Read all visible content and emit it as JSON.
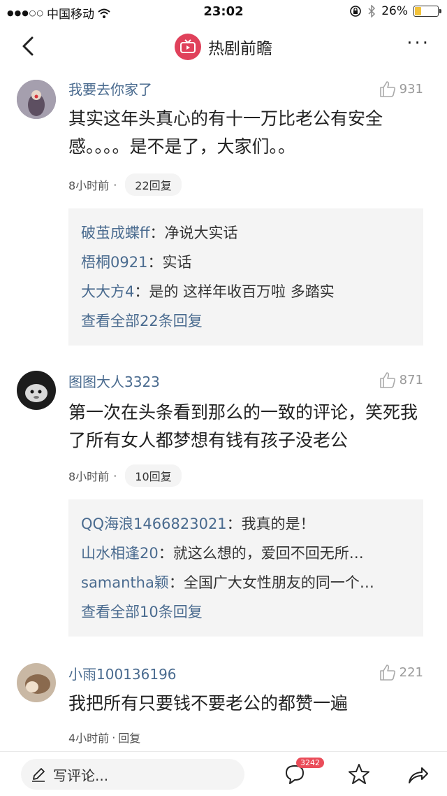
{
  "status_bar": {
    "signal": "●●●○○",
    "carrier": "中国移动",
    "time": "23:02",
    "battery": "26%",
    "battery_level": 0.26
  },
  "nav": {
    "title": "热剧前瞻",
    "more": "···"
  },
  "comments": [
    {
      "username": "我要去你家了",
      "likes": "931",
      "text": "其实这年头真心的有十一万比老公有安全感。。。。是不是了，大家们。。",
      "time": "8小时前",
      "sep": "·",
      "reply_count": "22回复",
      "replies": [
        {
          "user": "破茧成蝶ff",
          "text": "：净说大实话"
        },
        {
          "user": "梧桐0921",
          "text": "：实话"
        },
        {
          "user": "大大方4",
          "text": "：是的 这样年收百万啦  多踏实"
        }
      ],
      "view_all": "查看全部22条回复"
    },
    {
      "username": "图图大人3323",
      "likes": "871",
      "text": "第一次在头条看到那么的一致的评论，笑死我了所有女人都梦想有钱有孩子没老公",
      "time": "8小时前",
      "sep": "·",
      "reply_count": "10回复",
      "replies": [
        {
          "user": "QQ海浪1466823021",
          "text": "：我真的是！"
        },
        {
          "user": "山水相逢20",
          "text": "：就这么想的，爱回不回无所…"
        },
        {
          "user": "samantha颖",
          "text": "：全国广大女性朋友的同一个…"
        }
      ],
      "view_all": "查看全部10条回复"
    },
    {
      "username": "小雨100136196",
      "likes": "221",
      "text": "我把所有只要钱不要老公的都赞一遍",
      "time": "4小时前",
      "sep": "·",
      "reply_count": "回复"
    }
  ],
  "bottom_bar": {
    "write_placeholder": "写评论...",
    "comment_badge": "3242"
  }
}
